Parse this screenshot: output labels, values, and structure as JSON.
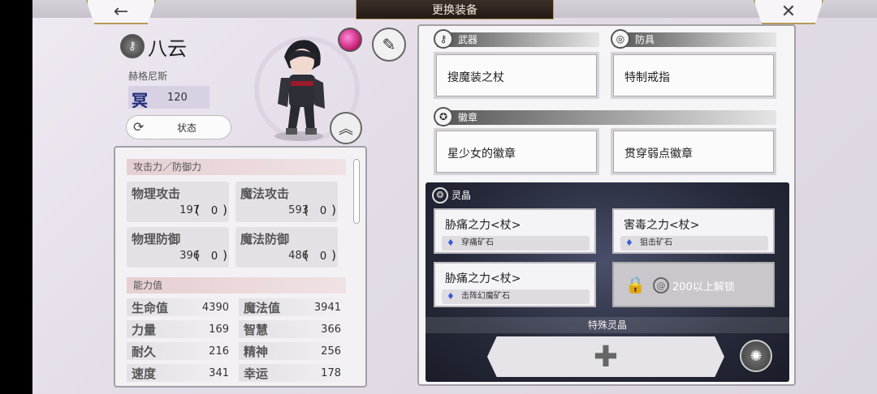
{
  "header": {
    "title": "更换装备",
    "back_icon": "←",
    "close_icon": "✕"
  },
  "character": {
    "name": "八云",
    "title": "赫格尼斯",
    "level_kanji": "冥",
    "level_value": "120",
    "status_label": "状态"
  },
  "stats": {
    "attack_defense_header": "攻击力／防御力",
    "cards": [
      {
        "label": "物理攻击",
        "value": "197",
        "bonus": "0"
      },
      {
        "label": "魔法攻击",
        "value": "593",
        "bonus": "0"
      },
      {
        "label": "物理防御",
        "value": "396",
        "bonus": "0"
      },
      {
        "label": "魔法防御",
        "value": "486",
        "bonus": "0"
      }
    ],
    "ability_header": "能力值",
    "abilities": [
      {
        "label": "生命值",
        "value": "4390"
      },
      {
        "label": "魔法值",
        "value": "3941"
      },
      {
        "label": "力量",
        "value": "169"
      },
      {
        "label": "智慧",
        "value": "366"
      },
      {
        "label": "耐久",
        "value": "216"
      },
      {
        "label": "精神",
        "value": "256"
      },
      {
        "label": "速度",
        "value": "341"
      },
      {
        "label": "幸运",
        "value": "178"
      }
    ]
  },
  "equipment": {
    "weapon_header": "武器",
    "armor_header": "防具",
    "weapon": "搜魔装之杖",
    "armor": "特制戒指",
    "badge_header": "徽章",
    "badges": [
      "星少女的徽章",
      "贯穿弱点徽章"
    ]
  },
  "crystals": {
    "header": "灵晶",
    "slots": [
      {
        "name": "胁痛之力<杖>",
        "ore": "穿痛矿石"
      },
      {
        "name": "害毒之力<杖>",
        "ore": "狙击矿石"
      },
      {
        "name": "胁痛之力<杖>",
        "ore": "击阵幻魔矿石"
      }
    ],
    "locked_text": "200以上解锁",
    "special_header": "特殊灵晶",
    "add_symbol": "✚"
  },
  "colors": {
    "level_kanji": "#1d2b7a",
    "title_bar": "#2e2420",
    "frame_gold": "#b59a56",
    "crystal_bg": "#2a2e40"
  }
}
